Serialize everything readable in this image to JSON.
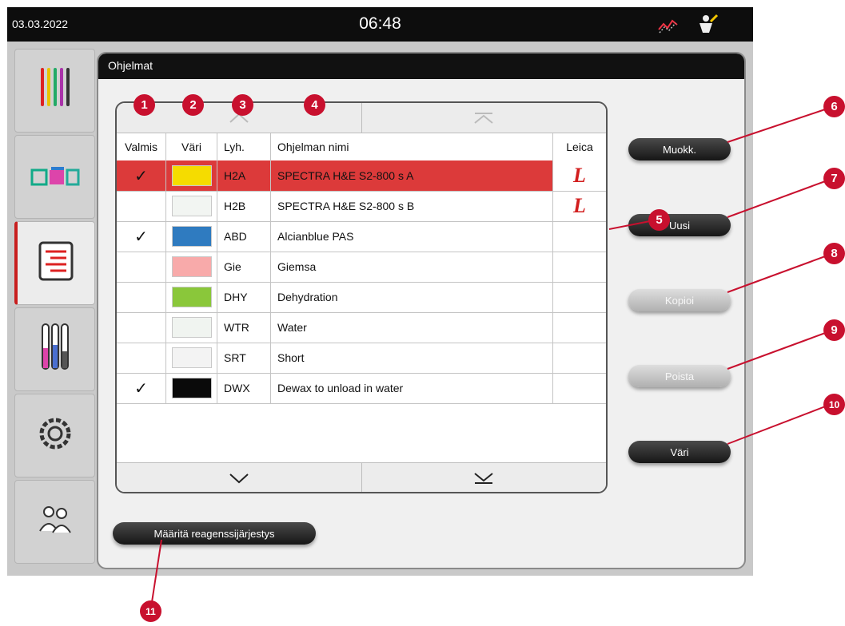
{
  "topbar": {
    "date": "03.03.2022",
    "time": "06:48"
  },
  "sidebar": {
    "items": [
      {
        "name": "programs"
      },
      {
        "name": "bath-layout"
      },
      {
        "name": "program-list",
        "active": true
      },
      {
        "name": "reagent-list"
      },
      {
        "name": "settings"
      },
      {
        "name": "user"
      }
    ]
  },
  "panel": {
    "title": "Ohjelmat"
  },
  "table": {
    "headers": {
      "valmis": "Valmis",
      "vari": "Väri",
      "lyh": "Lyh.",
      "name": "Ohjelman nimi",
      "leica": "Leica"
    },
    "rows": [
      {
        "ready": true,
        "color": "#f5dc00",
        "abbr": "H2A",
        "name": "SPECTRA H&E S2-800 s A",
        "leica": true,
        "selected": true
      },
      {
        "ready": false,
        "color": "#f2f5f2",
        "abbr": "H2B",
        "name": "SPECTRA H&E S2-800 s B",
        "leica": true
      },
      {
        "ready": true,
        "color": "#2f7bc0",
        "abbr": "ABD",
        "name": "Alcianblue PAS",
        "leica": false
      },
      {
        "ready": false,
        "color": "#f8aaaa",
        "abbr": "Gie",
        "name": "Giemsa",
        "leica": false
      },
      {
        "ready": false,
        "color": "#8ac73a",
        "abbr": "DHY",
        "name": "Dehydration",
        "leica": false
      },
      {
        "ready": false,
        "color": "#f0f4f0",
        "abbr": "WTR",
        "name": "Water",
        "leica": false
      },
      {
        "ready": false,
        "color": "#f3f3f3",
        "abbr": "SRT",
        "name": "Short",
        "leica": false
      },
      {
        "ready": true,
        "color": "#0a0a0a",
        "abbr": "DWX",
        "name": "Dewax to unload in water",
        "leica": false
      }
    ],
    "check_mark": "✓",
    "leica_logo": "L"
  },
  "buttons": {
    "edit": "Muokk.",
    "new": "Uusi",
    "copy": "Kopioi",
    "delete": "Poista",
    "color": "Väri",
    "reagent_order": "Määritä reagenssijärjestys"
  },
  "callouts": [
    "1",
    "2",
    "3",
    "4",
    "5",
    "6",
    "7",
    "8",
    "9",
    "10",
    "11"
  ],
  "colors": {
    "accent": "#c8102e",
    "selected_row": "#dc3a3a",
    "topbar": "#0d0d0d"
  }
}
